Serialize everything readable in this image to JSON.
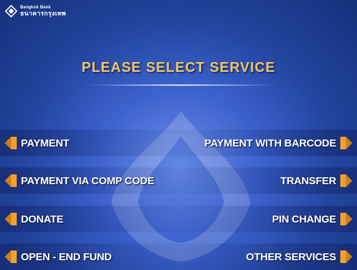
{
  "logo": {
    "name_en": "Bangkok Bank",
    "name_th": "ธนาคารกรุงเทพ"
  },
  "title": "PLEASE SELECT SERVICE",
  "colors": {
    "title": "#f0c66a",
    "arrow": "#f0a030",
    "background_center": "#6d8fe6",
    "background_edge": "#15307a"
  },
  "options": {
    "left": [
      {
        "label": "PAYMENT",
        "icon": "arrow-left-icon"
      },
      {
        "label": "PAYMENT VIA COMP CODE",
        "icon": "arrow-left-icon"
      },
      {
        "label": "DONATE",
        "icon": "arrow-left-icon"
      },
      {
        "label": "OPEN - END FUND",
        "icon": "arrow-left-icon"
      }
    ],
    "right": [
      {
        "label": "PAYMENT WITH BARCODE",
        "icon": "arrow-right-icon"
      },
      {
        "label": "TRANSFER",
        "icon": "arrow-right-icon"
      },
      {
        "label": "PIN CHANGE",
        "icon": "arrow-right-icon"
      },
      {
        "label": "OTHER SERVICES",
        "icon": "arrow-right-icon"
      }
    ]
  }
}
